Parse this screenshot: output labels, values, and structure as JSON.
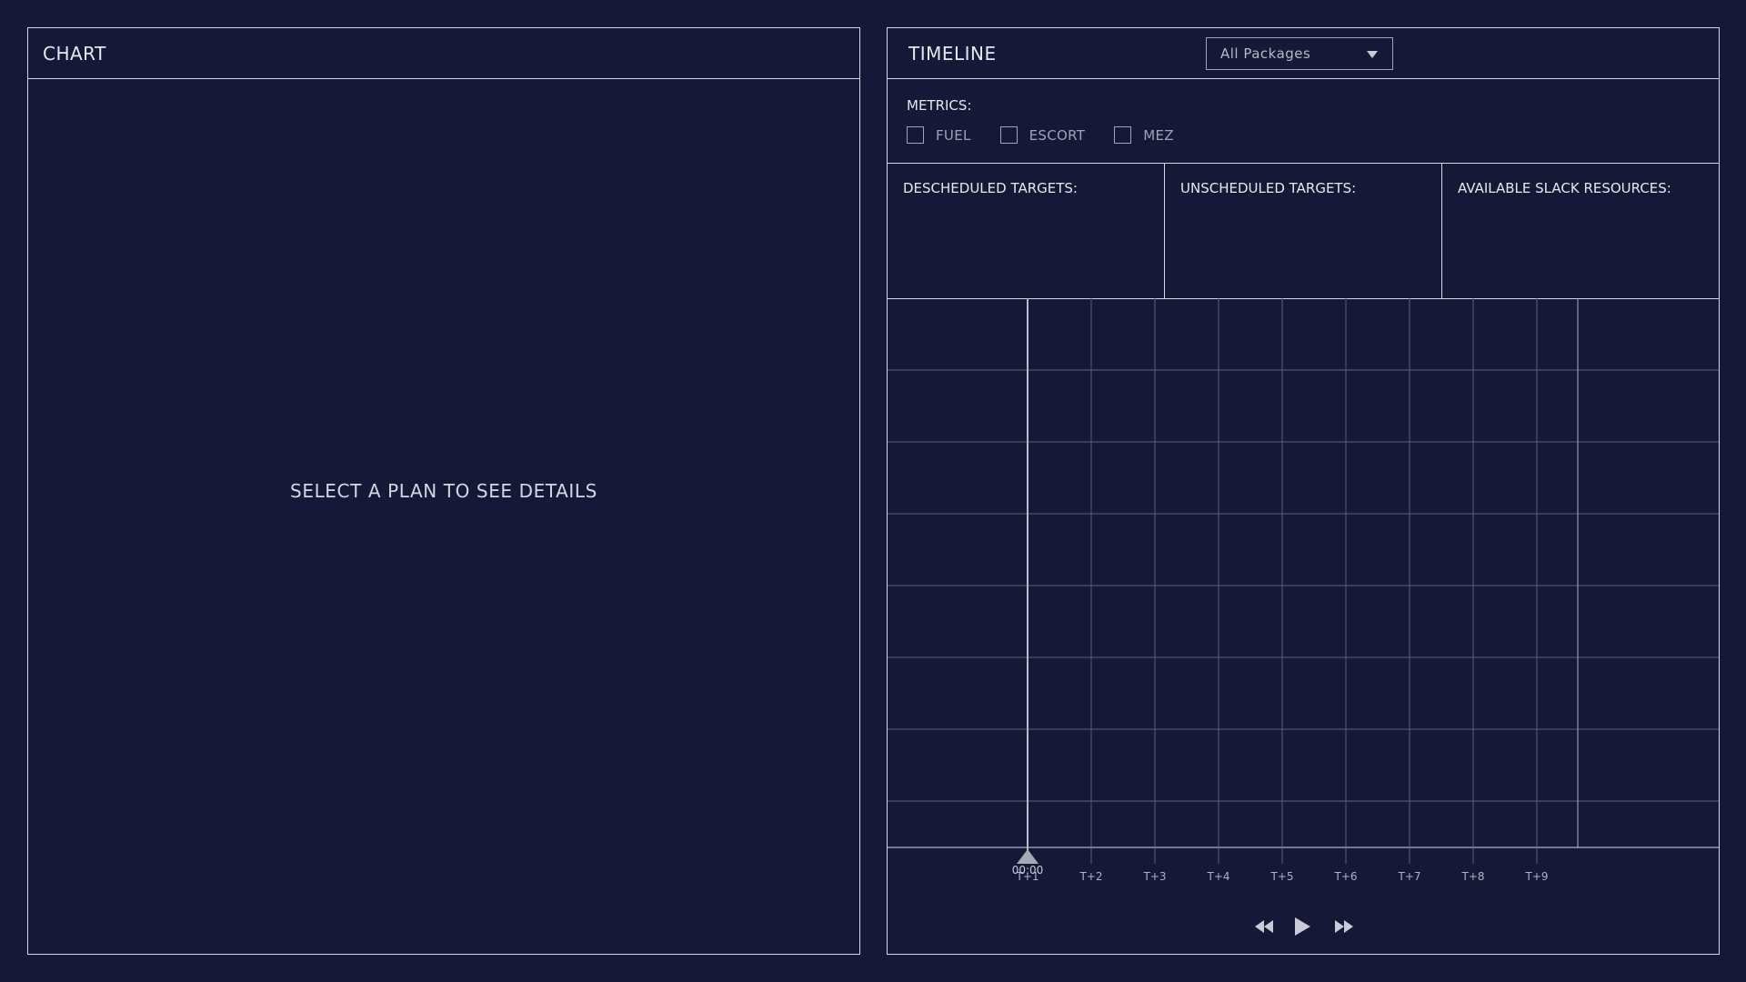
{
  "chart_panel": {
    "title": "CHART",
    "placeholder": "SELECT A PLAN TO SEE DETAILS"
  },
  "timeline_panel": {
    "title": "TIMELINE",
    "package_select": {
      "value": "All Packages"
    },
    "metrics": {
      "label": "METRICS:",
      "options": [
        {
          "label": "FUEL",
          "checked": false
        },
        {
          "label": "ESCORT",
          "checked": false
        },
        {
          "label": "MEZ",
          "checked": false
        }
      ]
    },
    "targets": [
      {
        "title": "DESCHEDULED TARGETS:"
      },
      {
        "title": "UNSCHEDULED TARGETS:"
      },
      {
        "title": "AVAILABLE SLACK RESOURCES:"
      }
    ],
    "timeline": {
      "cursor_time": "00:00",
      "ticks": [
        "T+1",
        "T+2",
        "T+3",
        "T+4",
        "T+5",
        "T+6",
        "T+7",
        "T+8",
        "T+9"
      ]
    },
    "controls": {
      "rewind_icon": "rewind-icon",
      "play_icon": "play-icon",
      "forward_icon": "fast-forward-icon"
    }
  },
  "colors": {
    "background": "#151937",
    "border": "#d7d9e2",
    "grid": "#5b5f76",
    "muted_text": "#9ea3b8"
  }
}
